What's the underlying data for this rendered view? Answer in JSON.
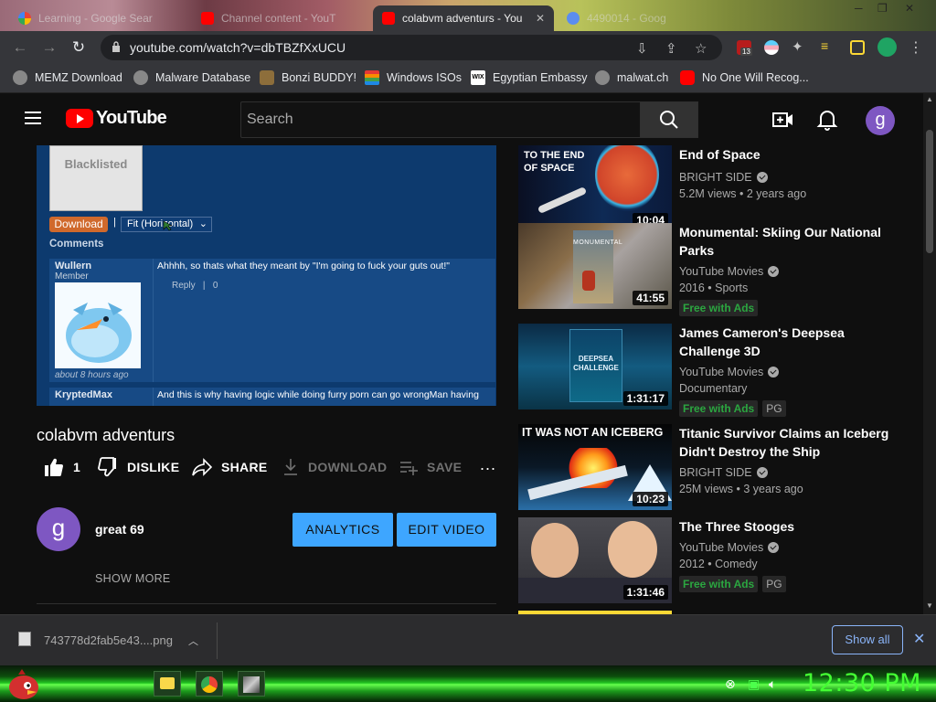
{
  "browser": {
    "tabs": [
      {
        "title": "Learning - Google Sear",
        "active": false
      },
      {
        "title": "Channel content - YouT",
        "active": false
      },
      {
        "title": "colabvm adventurs - You",
        "active": true
      },
      {
        "title": "4490014 - Goog",
        "active": false
      }
    ],
    "url": "youtube.com/watch?v=dbTBZfXxUCU",
    "extension_badge": "13",
    "bookmarks": [
      "MEMZ Download",
      "Malware Database",
      "Bonzi BUDDY!",
      "Windows ISOs",
      "Egyptian Embassy",
      "malwat.ch",
      "No One Will Recog..."
    ]
  },
  "youtube": {
    "logo": "YouTube",
    "search_placeholder": "Search",
    "user_initial": "g"
  },
  "video_frame": {
    "blacklisted": "Blacklisted",
    "download": "Download",
    "separator": "|",
    "fit": "Fit (Horizontal)",
    "comments_heading": "Comments",
    "comments": [
      {
        "user": "Wullern",
        "role": "Member",
        "text": "Ahhhh, so thats what they meant by \"I'm going to fuck your guts out!\"",
        "time": "about 8 hours ago",
        "reply": "Reply",
        "count": "0"
      },
      {
        "user": "KryptedMax",
        "role": "",
        "text": "And this is why having logic while doing furry porn can go wrongMan having",
        "time": "",
        "reply": "",
        "count": ""
      }
    ]
  },
  "video": {
    "title": "colabvm adventurs",
    "likes": "1",
    "dislike": "DISLIKE",
    "share": "SHARE",
    "download": "DOWNLOAD",
    "save": "SAVE",
    "more": "..."
  },
  "channel": {
    "initial": "g",
    "name": "great 69",
    "analytics": "ANALYTICS",
    "edit": "EDIT VIDEO",
    "show_more": "SHOW MORE"
  },
  "suggestions": [
    {
      "title": "End of Space",
      "channel": "BRIGHT SIDE",
      "meta": "5.2M views • 2 years ago",
      "duration": "10:04",
      "thumb_text": "TO THE END OF SPACE",
      "free": "",
      "rating": ""
    },
    {
      "title": "Monumental: Skiing Our National Parks",
      "channel": "YouTube Movies",
      "meta": "2016 • Sports",
      "duration": "41:55",
      "thumb_text": "MONUMENTAL",
      "free": "Free with Ads",
      "rating": ""
    },
    {
      "title": "James Cameron's Deepsea Challenge 3D",
      "channel": "YouTube Movies",
      "meta": "Documentary",
      "duration": "1:31:17",
      "thumb_text": "DEEPSEA CHALLENGE",
      "free": "Free with Ads",
      "rating": "PG"
    },
    {
      "title": "Titanic Survivor Claims an Iceberg Didn't Destroy the Ship",
      "channel": "BRIGHT SIDE",
      "meta": "25M views • 3 years ago",
      "duration": "10:23",
      "thumb_text": "IT WAS NOT AN ICEBERG",
      "free": "",
      "rating": ""
    },
    {
      "title": "The Three Stooges",
      "channel": "YouTube Movies",
      "meta": "2012 • Comedy",
      "duration": "1:31:46",
      "thumb_text": "",
      "free": "Free with Ads",
      "rating": "PG"
    }
  ],
  "downloads": {
    "file": "743778d2fab5e43....png",
    "show_all": "Show all",
    "close": "✕"
  },
  "taskbar": {
    "clock": "12:30 PM"
  },
  "colors": {
    "yt_bg": "#0f0f0f",
    "accent_blue": "#3ea6ff",
    "free_green": "#2ba640",
    "clock_green": "#44ff33"
  }
}
